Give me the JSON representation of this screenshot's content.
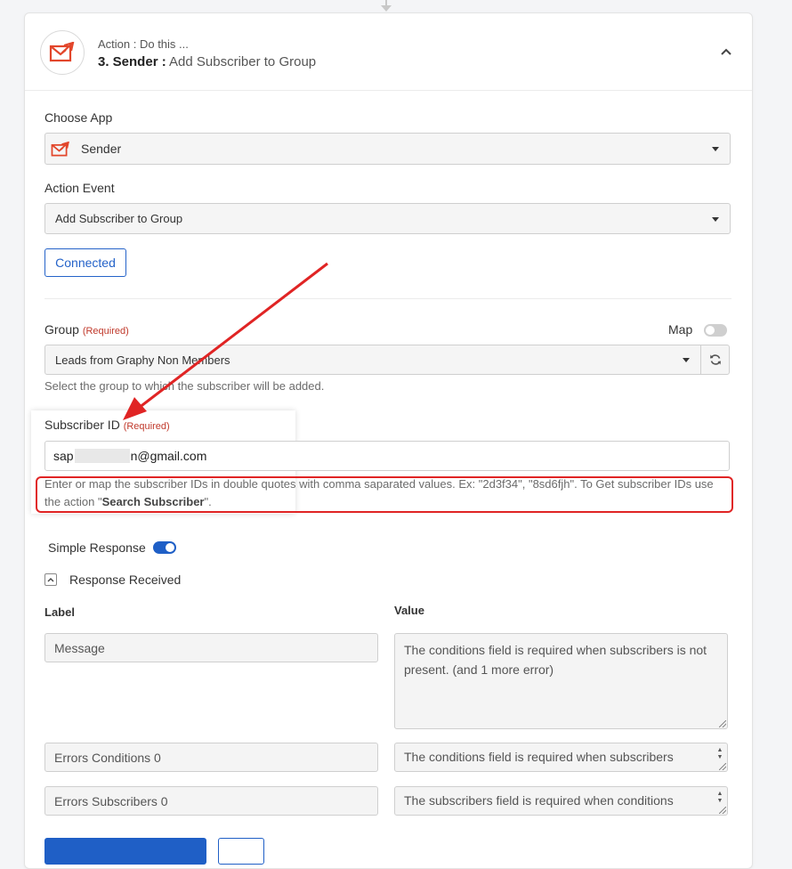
{
  "header": {
    "subtitle": "Action : Do this ...",
    "step": "3. Sender :",
    "event": "Add Subscriber to Group"
  },
  "choose_app": {
    "label": "Choose App",
    "value": "Sender"
  },
  "action_event": {
    "label": "Action Event",
    "value": "Add Subscriber to Group"
  },
  "connected_label": "Connected",
  "group": {
    "label": "Group",
    "required": "(Required)",
    "map_label": "Map",
    "value": "Leads from Graphy Non Members",
    "help": "Select the group to which the subscriber will be added."
  },
  "subscriber_id": {
    "label": "Subscriber ID",
    "required": "(Required)",
    "value_prefix": "sap",
    "value_suffix": "n@gmail.com",
    "help_text": "Enter or map the subscriber IDs in double quotes with comma saparated values. Ex: \"2d3f34\", \"8sd6fjh\". To Get subscriber IDs use the action \"",
    "help_action": "Search Subscriber",
    "help_end": "\"."
  },
  "simple_response": {
    "label": "Simple Response"
  },
  "response_received": {
    "label": "Response Received"
  },
  "response_table": {
    "label_header": "Label",
    "value_header": "Value",
    "rows": [
      {
        "label": "Message",
        "value": "The conditions field is required when subscribers is not present. (and 1 more error)"
      },
      {
        "label": "Errors Conditions 0",
        "value": "The conditions field is required when subscribers"
      },
      {
        "label": "Errors Subscribers 0",
        "value": "The subscribers field is required when conditions"
      }
    ]
  },
  "colors": {
    "accent": "#1f5fc6",
    "brand_sender": "#e2462b",
    "annotation_red": "#e02424",
    "required_red": "#c0392b"
  }
}
